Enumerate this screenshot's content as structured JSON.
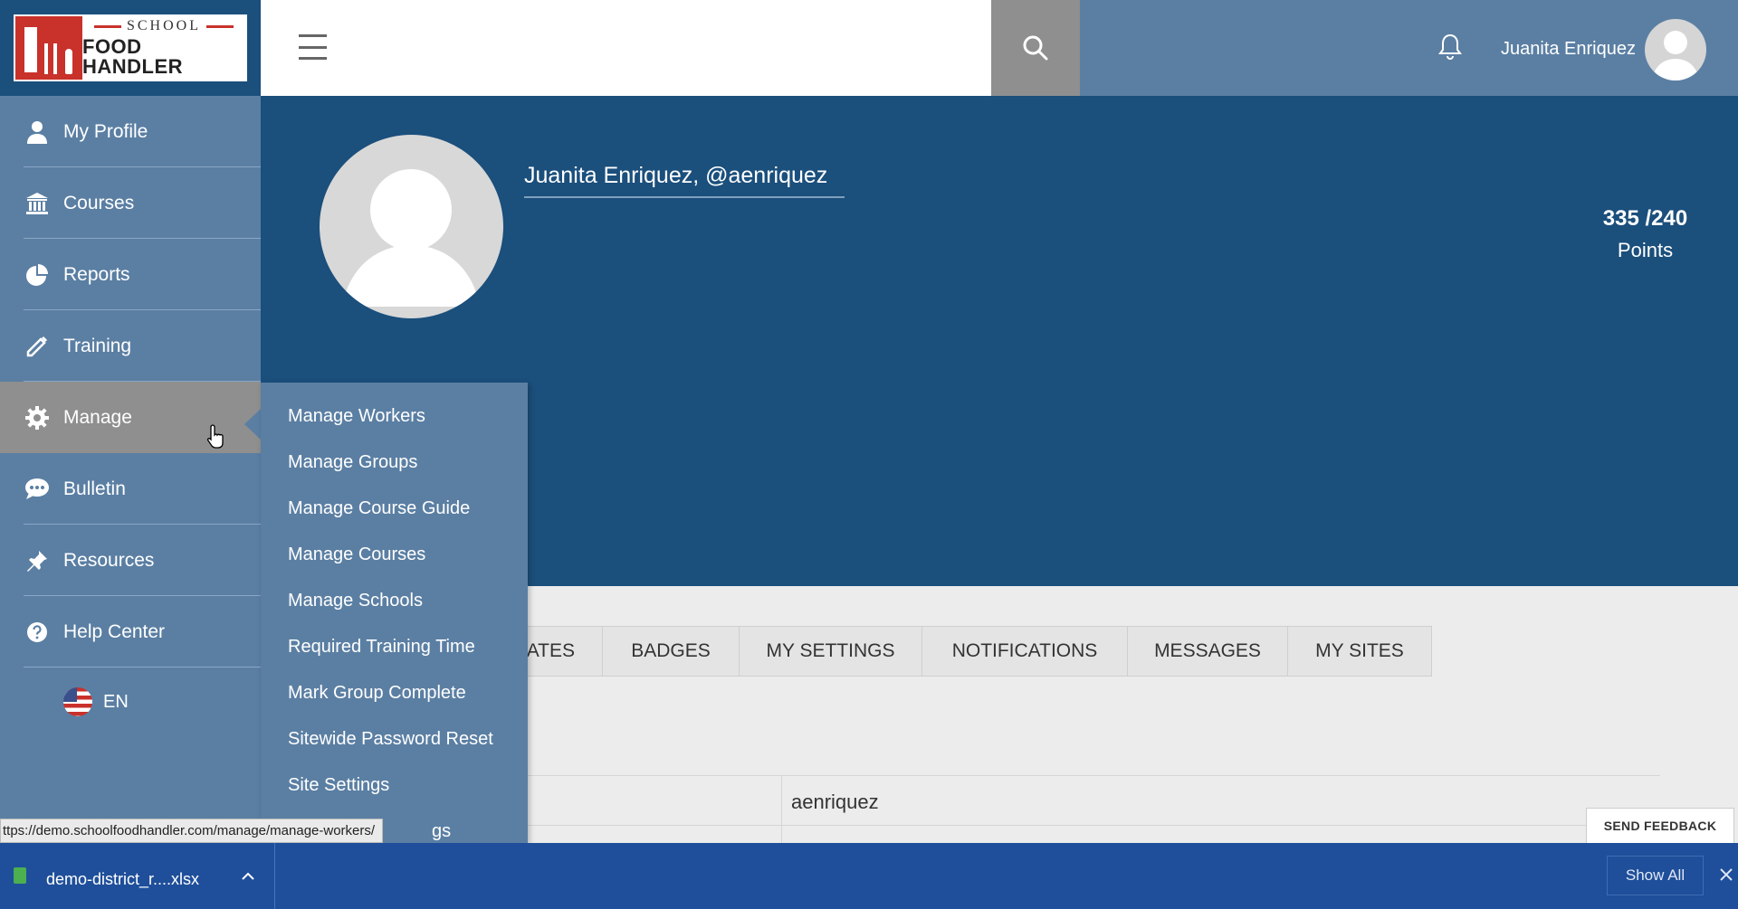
{
  "logo": {
    "top_text": "SCHOOL",
    "bottom_text": "FOOD HANDLER"
  },
  "header": {
    "user_name": "Juanita Enriquez"
  },
  "sidebar": {
    "items": [
      {
        "label": "My Profile",
        "icon": "person-icon"
      },
      {
        "label": "Courses",
        "icon": "bank-icon"
      },
      {
        "label": "Reports",
        "icon": "pie-chart-icon"
      },
      {
        "label": "Training",
        "icon": "pencil-icon"
      },
      {
        "label": "Manage",
        "icon": "gear-icon"
      },
      {
        "label": "Bulletin",
        "icon": "chat-bubble-icon"
      },
      {
        "label": "Resources",
        "icon": "pushpin-icon"
      },
      {
        "label": "Help Center",
        "icon": "question-circle-icon"
      }
    ],
    "language": "EN"
  },
  "profile": {
    "name_handle": "Juanita Enriquez, @aenriquez",
    "points_value": "335 /240",
    "points_label": "Points"
  },
  "manage_menu": {
    "items": [
      "Manage Workers",
      "Manage Groups",
      "Manage Course Guide",
      "Manage Courses",
      "Manage Schools",
      "Required Training Time",
      "Mark Group Complete",
      "Sitewide Password Reset",
      "Site Settings"
    ],
    "partial_item": "gs"
  },
  "tabs": [
    "ATES",
    "BADGES",
    "MY SETTINGS",
    "NOTIFICATIONS",
    "MESSAGES",
    "MY SITES"
  ],
  "content": {
    "username_value": "aenriquez"
  },
  "feedback": {
    "label": "SEND FEEDBACK"
  },
  "status_url": "ttps://demo.schoolfoodhandler.com/manage/manage-workers/",
  "download_bar": {
    "file_name": "demo-district_r....xlsx",
    "show_all": "Show All"
  },
  "colors": {
    "sidebar": "#5b7fa3",
    "header_blue": "#1b4f7c",
    "active_gray": "#8f8f8f",
    "brand_red": "#c9312b",
    "download_bar": "#1f4f9a"
  }
}
